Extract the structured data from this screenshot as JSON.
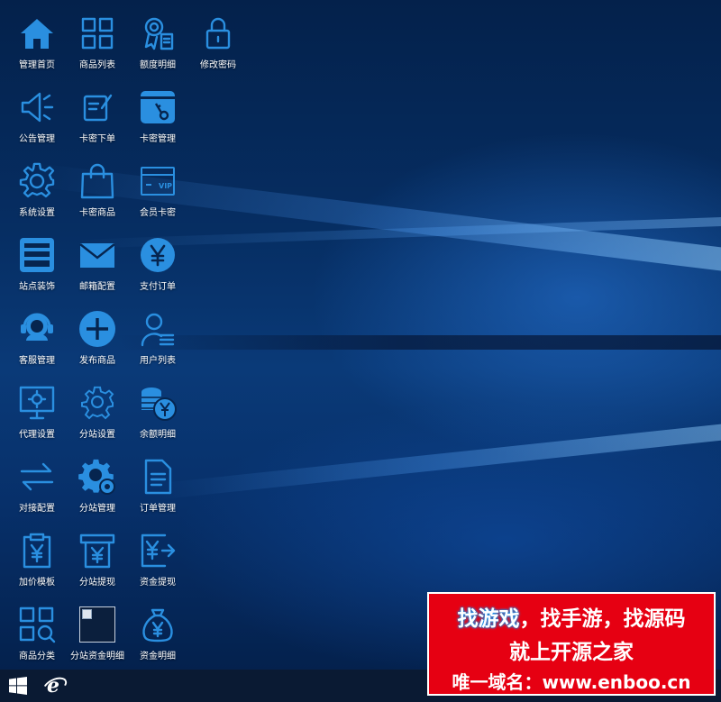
{
  "desktop": {
    "icons": [
      {
        "label": "管理首页",
        "icon": "home-icon"
      },
      {
        "label": "商品列表",
        "icon": "grid-icon"
      },
      {
        "label": "额度明细",
        "icon": "certificate-icon"
      },
      {
        "label": "修改密码",
        "icon": "lock-icon"
      },
      {
        "label": "公告管理",
        "icon": "megaphone-icon"
      },
      {
        "label": "卡密下单",
        "icon": "edit-note-icon"
      },
      {
        "label": "卡密管理",
        "icon": "card-key-icon"
      },
      {
        "label": "系统设置",
        "icon": "gear-icon"
      },
      {
        "label": "卡密商品",
        "icon": "shopping-bag-icon"
      },
      {
        "label": "会员卡密",
        "icon": "vip-card-icon"
      },
      {
        "label": "站点装饰",
        "icon": "layout-icon"
      },
      {
        "label": "邮箱配置",
        "icon": "mail-icon"
      },
      {
        "label": "支付订单",
        "icon": "yen-coin-icon"
      },
      {
        "label": "客服管理",
        "icon": "headset-icon"
      },
      {
        "label": "发布商品",
        "icon": "plus-circle-icon"
      },
      {
        "label": "用户列表",
        "icon": "user-list-icon"
      },
      {
        "label": "代理设置",
        "icon": "monitor-gear-icon"
      },
      {
        "label": "分站设置",
        "icon": "gear-outline-icon"
      },
      {
        "label": "余额明细",
        "icon": "coins-icon"
      },
      {
        "label": "对接配置",
        "icon": "swap-arrows-icon"
      },
      {
        "label": "分站管理",
        "icon": "gears-icon"
      },
      {
        "label": "订单管理",
        "icon": "document-icon"
      },
      {
        "label": "加价模板",
        "icon": "clipboard-yen-icon"
      },
      {
        "label": "分站提现",
        "icon": "atm-yen-icon"
      },
      {
        "label": "资金提现",
        "icon": "yen-transfer-icon"
      },
      {
        "label": "商品分类",
        "icon": "category-search-icon"
      },
      {
        "label": "分站资金明细",
        "icon": "broken-image-icon"
      },
      {
        "label": "资金明细",
        "icon": "money-bag-icon"
      }
    ]
  },
  "taskbar": {
    "start_icon": "windows-start-icon",
    "browser_icon": "internet-explorer-icon",
    "browser_glyph": "e"
  },
  "watermark": {
    "line1_part1": "找游戏",
    "line1_part2": "，找手游，找源码",
    "line2": "就上开源之家",
    "line3": "唯一域名：www.enboo.cn",
    "background": "#e60012"
  },
  "colors": {
    "icon_blue": "#2a8fe0",
    "taskbar": "#0a1a33"
  }
}
